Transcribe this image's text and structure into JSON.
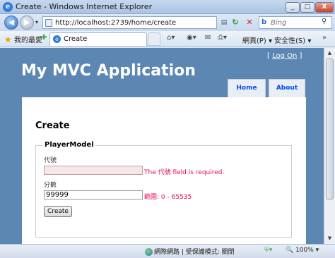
{
  "window": {
    "title": "Create - Windows Internet Explorer",
    "minimize": "_",
    "maximize": "□",
    "close": "X"
  },
  "addressbar": {
    "url": "http://localhost:2739/home/create",
    "search_placeholder": "Bing"
  },
  "favbar": {
    "favorites_label": "我的最愛",
    "tab_title": "Create",
    "page_menu": "網頁(P) ▾",
    "safety_menu": "安全性(S) ▾"
  },
  "site": {
    "login_open": "[ ",
    "login_link": "Log On",
    "login_close": " ]",
    "title": "My MVC Application",
    "menu": [
      {
        "label": "Home"
      },
      {
        "label": "About"
      }
    ]
  },
  "form": {
    "heading": "Create",
    "legend": "PlayerModel",
    "fields": [
      {
        "label": "代號",
        "value": "",
        "error": "The 代號 field is required."
      },
      {
        "label": "分數",
        "value": "99999",
        "error": "範圍: 0 - 65535"
      }
    ],
    "submit_label": "Create"
  },
  "statusbar": {
    "zone": "網際網路 | 受保護模式: 關閉",
    "zoom": "100%"
  },
  "colors": {
    "page_bg": "#5c87b2",
    "error": "#e80c4d",
    "link": "#034af3"
  }
}
